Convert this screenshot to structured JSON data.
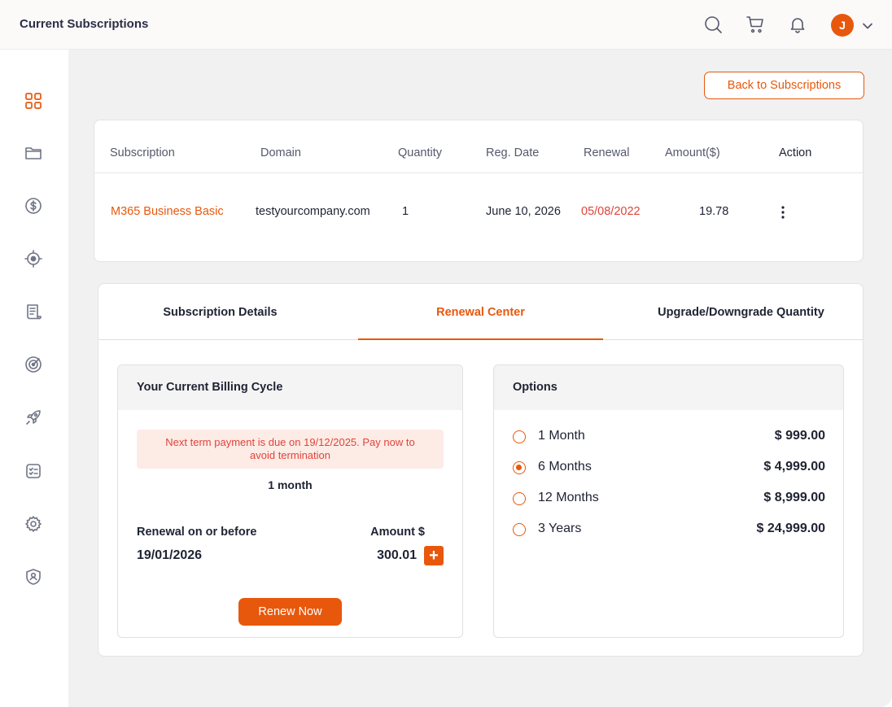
{
  "header": {
    "title": "Current Subscriptions",
    "avatar_initial": "J"
  },
  "sidebar": {
    "items": [
      {
        "icon": "dashboard-icon",
        "active": true
      },
      {
        "icon": "folder-icon"
      },
      {
        "icon": "dollar-icon"
      },
      {
        "icon": "target-icon"
      },
      {
        "icon": "scroll-icon"
      },
      {
        "icon": "radar-icon"
      },
      {
        "icon": "rocket-icon"
      },
      {
        "icon": "checklist-icon"
      },
      {
        "icon": "gear-icon"
      },
      {
        "icon": "shield-icon"
      }
    ]
  },
  "actions": {
    "back_label": "Back to Subscriptions"
  },
  "subscription_table": {
    "headers": [
      "Subscription",
      "Domain",
      "Quantity",
      "Reg. Date",
      "Renewal",
      "Amount($)",
      "Action"
    ],
    "row": {
      "subscription": "M365 Business Basic",
      "domain": "testyourcompany.com",
      "quantity": "1",
      "reg_date": "June 10, 2026",
      "renewal": "05/08/2022",
      "amount": "19.78"
    }
  },
  "tabs": [
    {
      "label": "Subscription Details"
    },
    {
      "label": "Renewal Center",
      "active": true
    },
    {
      "label": "Upgrade/Downgrade Quantity"
    }
  ],
  "billing": {
    "title": "Your Current Billing Cycle",
    "alert": "Next term payment is due on 19/12/2025. Pay now to avoid termination",
    "cycle": "1 month",
    "renewal_label": "Renewal on or before",
    "renewal_date": "19/01/2026",
    "amount_label": "Amount $",
    "amount_value": "300.01",
    "plus_label": "+",
    "renew_button": "Renew Now"
  },
  "options": {
    "title": "Options",
    "items": [
      {
        "label": "1 Month",
        "price": "$ 999.00",
        "selected": false
      },
      {
        "label": "6 Months",
        "price": "$ 4,999.00",
        "selected": true
      },
      {
        "label": "12 Months",
        "price": "$ 8,999.00",
        "selected": false
      },
      {
        "label": "3 Years",
        "price": "$ 24,999.00",
        "selected": false
      }
    ]
  },
  "colors": {
    "accent": "#e8580c",
    "danger": "#e0443a",
    "alert_bg": "#fdebe6"
  }
}
